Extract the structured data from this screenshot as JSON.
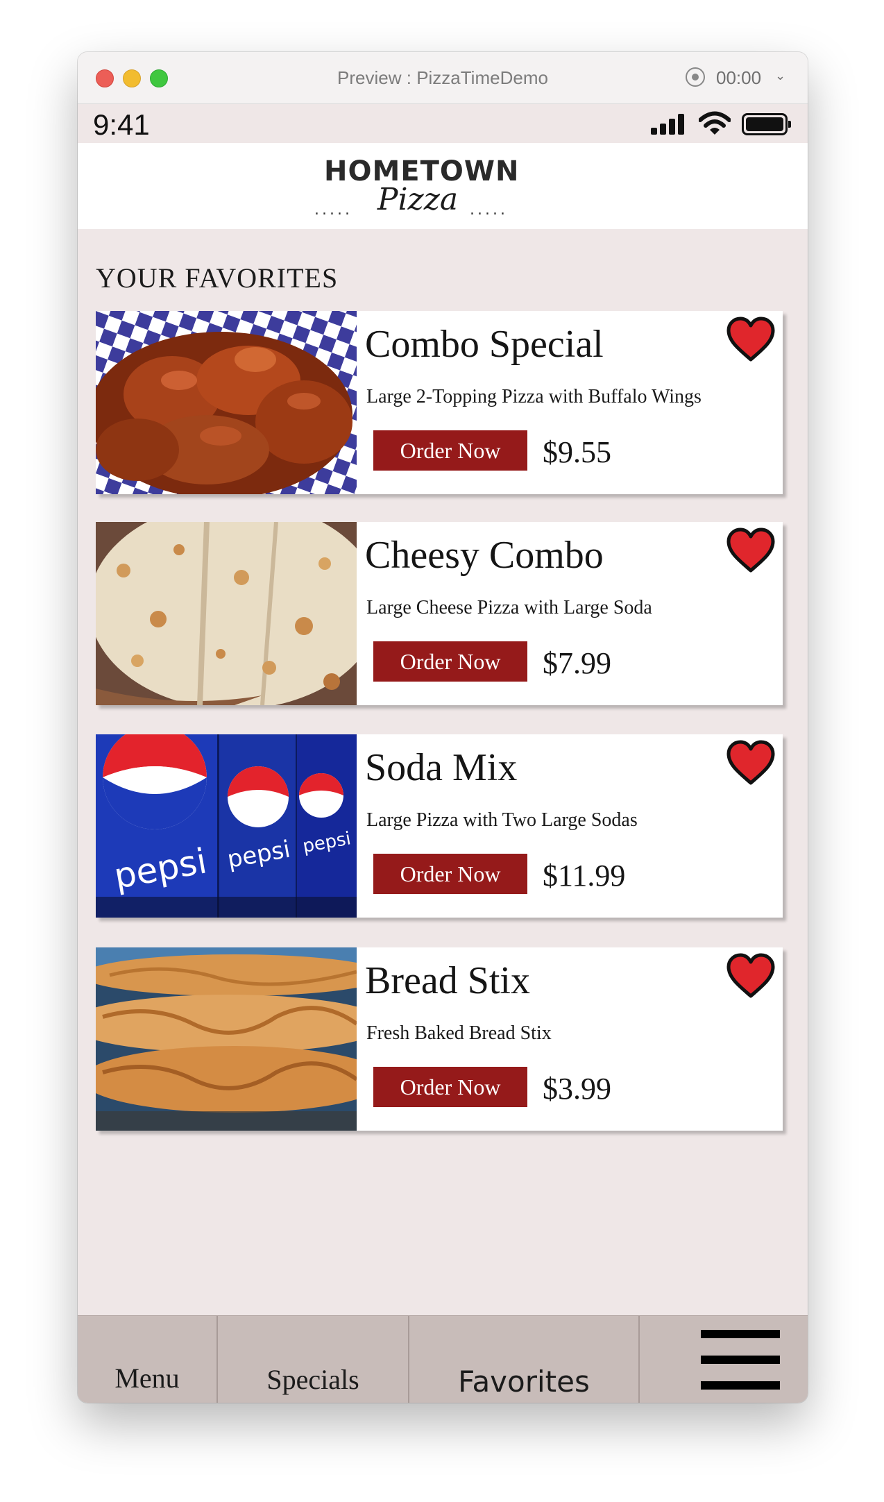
{
  "window": {
    "title": "Preview : PizzaTimeDemo",
    "timer": "00:00"
  },
  "status_bar": {
    "time": "9:41"
  },
  "header": {
    "logo_top": "HOMETOWN",
    "logo_script": "Pizza",
    "logo_dots": "....."
  },
  "section_title": "YOUR FAVORITES",
  "colors": {
    "accent": "#951a1a",
    "background": "#efe7e7",
    "tab_bar": "#c8bcb9",
    "heart": "#e0262c"
  },
  "favorites": [
    {
      "name": "Combo Special",
      "description": "Large 2-Topping Pizza with Buffalo Wings",
      "button": "Order Now",
      "price": "$9.55",
      "icon": "heart-icon"
    },
    {
      "name": "Cheesy Combo",
      "description": "Large Cheese Pizza with Large Soda",
      "button": "Order Now",
      "price": "$7.99",
      "icon": "heart-icon"
    },
    {
      "name": "Soda Mix",
      "description": "Large Pizza with Two Large Sodas",
      "button": "Order Now",
      "price": "$11.99",
      "icon": "heart-icon"
    },
    {
      "name": "Bread Stix",
      "description": "Fresh Baked Bread Stix",
      "button": "Order Now",
      "price": "$3.99",
      "icon": "heart-icon"
    }
  ],
  "tab_bar": {
    "tabs": [
      {
        "label": "Menu"
      },
      {
        "label": "Specials"
      },
      {
        "label": "Favorites"
      }
    ],
    "more_icon": "hamburger-menu-icon"
  }
}
